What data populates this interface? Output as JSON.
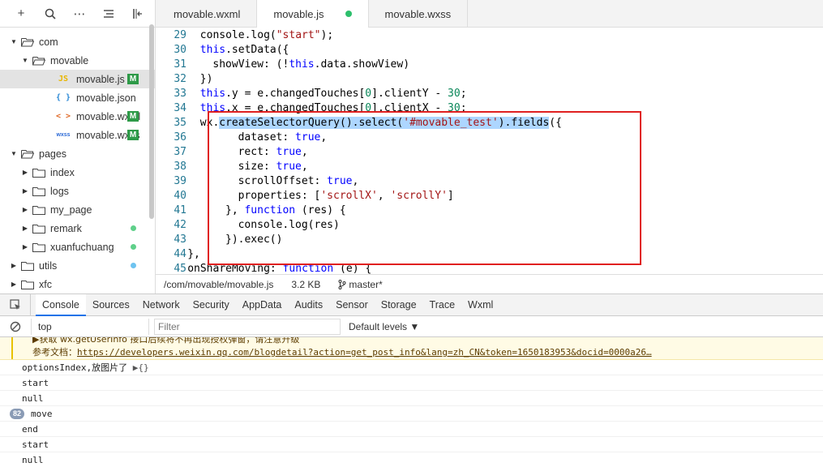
{
  "sidebar": {
    "toolbar": [
      "+",
      "⌕",
      "⋯",
      "≡",
      "⇤"
    ],
    "tree": [
      {
        "label": "com",
        "type": "folder",
        "open": true,
        "depth": 0
      },
      {
        "label": "movable",
        "type": "folder",
        "open": true,
        "depth": 1
      },
      {
        "label": "movable.js",
        "type": "js",
        "icon": "JS",
        "depth": 2,
        "selected": true,
        "badge": "M"
      },
      {
        "label": "movable.json",
        "type": "json",
        "icon": "{ }",
        "depth": 2
      },
      {
        "label": "movable.wxml",
        "type": "wxml",
        "icon": "< >",
        "depth": 2,
        "badge": "M"
      },
      {
        "label": "movable.wxss",
        "type": "wxss",
        "icon": "wxss",
        "depth": 2,
        "badge": "M"
      },
      {
        "label": "pages",
        "type": "folder",
        "open": true,
        "depth": 0
      },
      {
        "label": "index",
        "type": "folder",
        "open": false,
        "depth": 1
      },
      {
        "label": "logs",
        "type": "folder",
        "open": false,
        "depth": 1
      },
      {
        "label": "my_page",
        "type": "folder",
        "open": false,
        "depth": 1
      },
      {
        "label": "remark",
        "type": "folder",
        "open": false,
        "depth": 1,
        "dot": "#5fd08a"
      },
      {
        "label": "xuanfuchuang",
        "type": "folder",
        "open": false,
        "depth": 1,
        "dot": "#5fd08a"
      },
      {
        "label": "utils",
        "type": "folder",
        "open": false,
        "depth": 0,
        "dot": "#6ec3f0"
      },
      {
        "label": "xfc",
        "type": "folder",
        "open": false,
        "depth": 0
      }
    ]
  },
  "editor": {
    "tabs": [
      {
        "label": "movable.wxml",
        "active": false
      },
      {
        "label": "movable.js",
        "active": true,
        "modified": true
      },
      {
        "label": "movable.wxss",
        "active": false
      }
    ],
    "lines": [
      {
        "n": "29",
        "indent": 6,
        "html": "console.log(<span class=\"str\">\"start\"</span>);"
      },
      {
        "n": "30",
        "indent": 6,
        "html": "<span class=\"kw\">this</span>.setData({"
      },
      {
        "n": "31",
        "indent": 8,
        "html": "showView: (!<span class=\"kw\">this</span>.data.showView)"
      },
      {
        "n": "32",
        "indent": 6,
        "html": "})"
      },
      {
        "n": "33",
        "indent": 6,
        "html": "<span class=\"kw\">this</span>.y = e.changedTouches[<span class=\"num\">0</span>].clientY - <span class=\"num\">30</span>;"
      },
      {
        "n": "34",
        "indent": 6,
        "html": "<span class=\"kw\">this</span>.x = e.changedTouches[<span class=\"num\">0</span>].clientX - <span class=\"num\">30</span>;"
      },
      {
        "n": "35",
        "indent": 6,
        "html": "wx.<span class=\"hl\">createSelectorQuery().select(<span class=\"str\">'#movable_test'</span>).fields</span>({"
      },
      {
        "n": "36",
        "indent": 12,
        "html": "dataset: <span class=\"kw\">true</span>,"
      },
      {
        "n": "37",
        "indent": 12,
        "html": "rect: <span class=\"kw\">true</span>,"
      },
      {
        "n": "38",
        "indent": 12,
        "html": "size: <span class=\"kw\">true</span>,"
      },
      {
        "n": "39",
        "indent": 12,
        "html": "scrollOffset: <span class=\"kw\">true</span>,"
      },
      {
        "n": "40",
        "indent": 12,
        "html": "properties: [<span class=\"str\">'scrollX'</span>, <span class=\"str\">'scrollY'</span>]"
      },
      {
        "n": "41",
        "indent": 10,
        "html": "}, <span class=\"kw\">function</span> (res) {"
      },
      {
        "n": "42",
        "indent": 12,
        "html": "console.log(res)"
      },
      {
        "n": "43",
        "indent": 10,
        "html": "}).exec()"
      },
      {
        "n": "44",
        "indent": 4,
        "html": "},"
      },
      {
        "n": "45",
        "indent": 4,
        "html": "onShareMoving: <span class=\"kw\">function</span> (e) {"
      }
    ],
    "status": {
      "path": "/com/movable/movable.js",
      "size": "3.2 KB",
      "branch": "master*"
    }
  },
  "devtools": {
    "tabs": [
      "Console",
      "Sources",
      "Network",
      "Security",
      "AppData",
      "Audits",
      "Sensor",
      "Storage",
      "Trace",
      "Wxml"
    ],
    "active_tab": "Console",
    "context": "top",
    "filter_placeholder": "Filter",
    "levels": "Default levels ▼",
    "warning": {
      "line1": "▶获取 wx.getUserInfo 接口后续将不再出现授权弹窗，请注意升级",
      "line2_label": "参考文档：",
      "line2_link": "https://developers.weixin.qq.com/blogdetail?action=get_post_info&lang=zh_CN&token=1650183953&docid=0000a26…"
    },
    "logs": [
      {
        "text": "optionsIndex,放图片了 ",
        "obj": "▶{}"
      },
      {
        "text": "start"
      },
      {
        "text": "null"
      },
      {
        "text": "move",
        "count": "82"
      },
      {
        "text": "end"
      },
      {
        "text": "start"
      },
      {
        "text": "null"
      }
    ]
  }
}
